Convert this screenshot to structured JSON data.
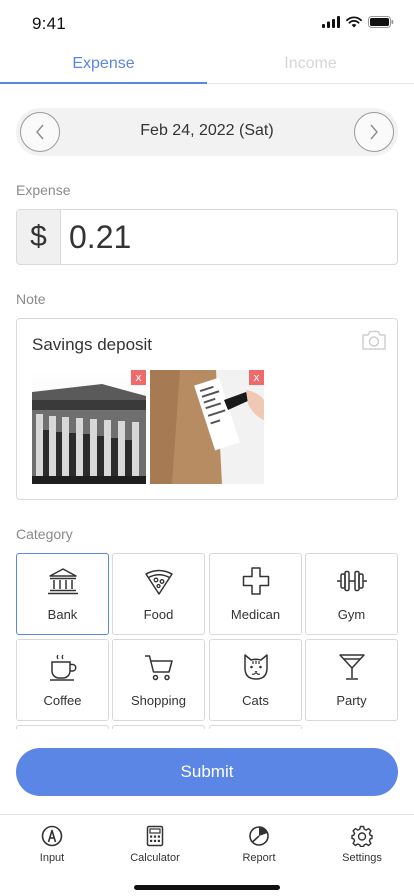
{
  "status_bar": {
    "time": "9:41"
  },
  "tabs": [
    {
      "label": "Expense",
      "active": true
    },
    {
      "label": "Income",
      "active": false
    }
  ],
  "date_picker": {
    "date": "Feb 24, 2022 (Sat)"
  },
  "amount": {
    "label": "Expense",
    "currency": "$",
    "value": "0.21"
  },
  "note": {
    "label": "Note",
    "text": "Savings deposit",
    "remove_glyph": "x"
  },
  "category": {
    "label": "Category",
    "selected": "Bank",
    "items": [
      {
        "label": "Bank",
        "icon": "bank-icon"
      },
      {
        "label": "Food",
        "icon": "pizza-icon"
      },
      {
        "label": "Medican",
        "icon": "medical-cross-icon"
      },
      {
        "label": "Gym",
        "icon": "dumbbell-icon"
      },
      {
        "label": "Coffee",
        "icon": "coffee-cup-icon"
      },
      {
        "label": "Shopping",
        "icon": "shopping-cart-icon"
      },
      {
        "label": "Cats",
        "icon": "cat-icon"
      },
      {
        "label": "Party",
        "icon": "cocktail-icon"
      }
    ]
  },
  "submit": {
    "label": "Submit"
  },
  "bottom_nav": [
    {
      "label": "Input",
      "icon": "pen-icon"
    },
    {
      "label": "Calculator",
      "icon": "calculator-icon"
    },
    {
      "label": "Report",
      "icon": "pie-chart-icon"
    },
    {
      "label": "Settings",
      "icon": "gear-icon"
    }
  ],
  "colors": {
    "accent": "#5b86e5",
    "remove": "#f06a6a",
    "border": "#d9d9d9"
  }
}
